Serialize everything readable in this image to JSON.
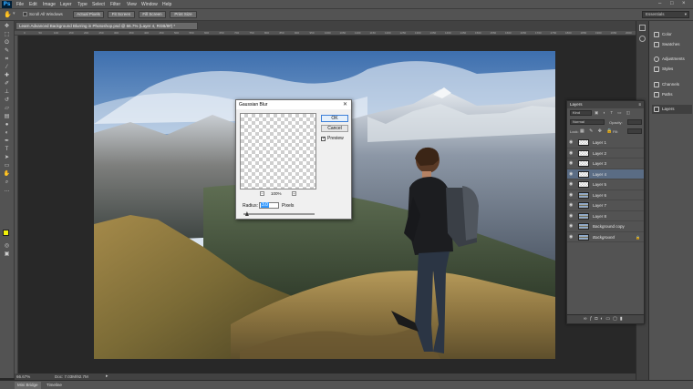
{
  "app": {
    "logo": "Ps"
  },
  "menu": [
    "File",
    "Edit",
    "Image",
    "Layer",
    "Type",
    "Select",
    "Filter",
    "View",
    "Window",
    "Help"
  ],
  "options_bar": {
    "scroll_all_label": "Scroll All Windows",
    "actual_pixels": "Actual Pixels",
    "fit_screen": "Fit Screen",
    "fill_screen": "Fill Screen",
    "print_size": "Print Size"
  },
  "workspace": "Essentials",
  "document": {
    "tab_title": "Learn Advanced Background Blurring in Photoshop.psd @ 66.7% (Layer 4, RGB/8#) *",
    "ruler_ticks": [
      "0",
      "50",
      "100",
      "150",
      "200",
      "250",
      "300",
      "350",
      "400",
      "450",
      "500",
      "550",
      "600",
      "650",
      "700",
      "750",
      "800",
      "850",
      "900",
      "950",
      "1000",
      "1050",
      "1100",
      "1150",
      "1200",
      "1250",
      "1300",
      "1350",
      "1400",
      "1450",
      "1500",
      "1550",
      "1600",
      "1650",
      "1700",
      "1750",
      "1800",
      "1850",
      "1900",
      "1950",
      "2000"
    ]
  },
  "status": {
    "zoom": "66.67%",
    "doc_size": "Doc: 7.03M/92.7M"
  },
  "bottom_tabs": [
    "Mini Bridge",
    "Timeline"
  ],
  "right_panel": {
    "items": [
      "Color",
      "Swatches",
      "Adjustments",
      "Styles",
      "Channels",
      "Paths",
      "Layers"
    ]
  },
  "layers_panel": {
    "title": "Layers",
    "kind_filter": "Kind",
    "blend_mode": "Normal",
    "opacity_label": "Opacity:",
    "lock_label": "Lock:",
    "fill_label": "Fill:",
    "layers": [
      {
        "name": "Layer 1",
        "thumb": "transparent",
        "selected": false
      },
      {
        "name": "Layer 2",
        "thumb": "transparent",
        "selected": false
      },
      {
        "name": "Layer 3",
        "thumb": "transparent",
        "selected": false
      },
      {
        "name": "Layer 4",
        "thumb": "transparent",
        "selected": true
      },
      {
        "name": "Layer 5",
        "thumb": "transparent",
        "selected": false
      },
      {
        "name": "Layer 6",
        "thumb": "photo",
        "selected": false
      },
      {
        "name": "Layer 7",
        "thumb": "photo",
        "selected": false
      },
      {
        "name": "Layer 8",
        "thumb": "photo",
        "selected": false
      },
      {
        "name": "Background copy",
        "thumb": "photo",
        "selected": false
      },
      {
        "name": "Background",
        "thumb": "photo",
        "selected": false
      }
    ]
  },
  "gaussian_blur": {
    "title": "Gaussian Blur",
    "ok": "OK",
    "cancel": "Cancel",
    "preview_label": "Preview",
    "preview_checked": true,
    "zoom_level": "100%",
    "radius_label": "Radius:",
    "radius_value": "3.0",
    "radius_unit": "Pixels",
    "radius_fraction": 0.05
  },
  "colors": {
    "accent_selected_layer": "#5a6c84",
    "foreground_swatch": "#f2f20a",
    "background_swatch": "#ffffff"
  }
}
